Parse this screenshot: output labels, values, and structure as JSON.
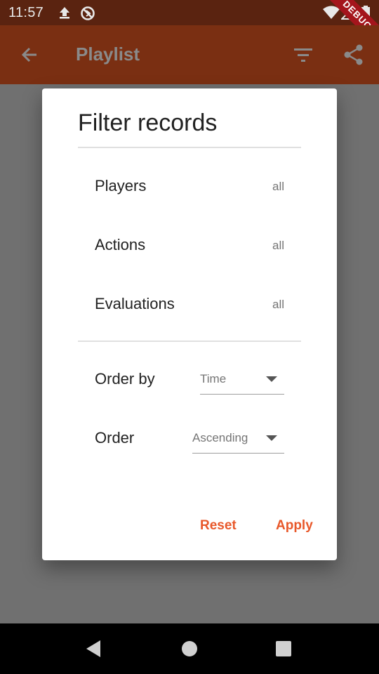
{
  "status_bar": {
    "time": "11:57",
    "debug_label": "DEBUG",
    "icons": [
      "upload-icon",
      "no-sync-icon",
      "wifi-icon",
      "signal-icon",
      "battery-icon"
    ]
  },
  "app_bar": {
    "title": "Playlist",
    "icons": [
      "back-arrow-icon",
      "filter-icon",
      "share-icon"
    ],
    "background_color": "#7a2f12"
  },
  "dialog": {
    "title": "Filter records",
    "filters": [
      {
        "label": "Players",
        "value": "all"
      },
      {
        "label": "Actions",
        "value": "all"
      },
      {
        "label": "Evaluations",
        "value": "all"
      }
    ],
    "order_by": {
      "label": "Order by",
      "selected": "Time"
    },
    "order": {
      "label": "Order",
      "selected": "Ascending"
    },
    "buttons": {
      "reset": "Reset",
      "apply": "Apply"
    },
    "accent_color": "#e8582a"
  },
  "nav_bar": {
    "icons": [
      "back-triangle-icon",
      "home-circle-icon",
      "recents-square-icon"
    ]
  }
}
